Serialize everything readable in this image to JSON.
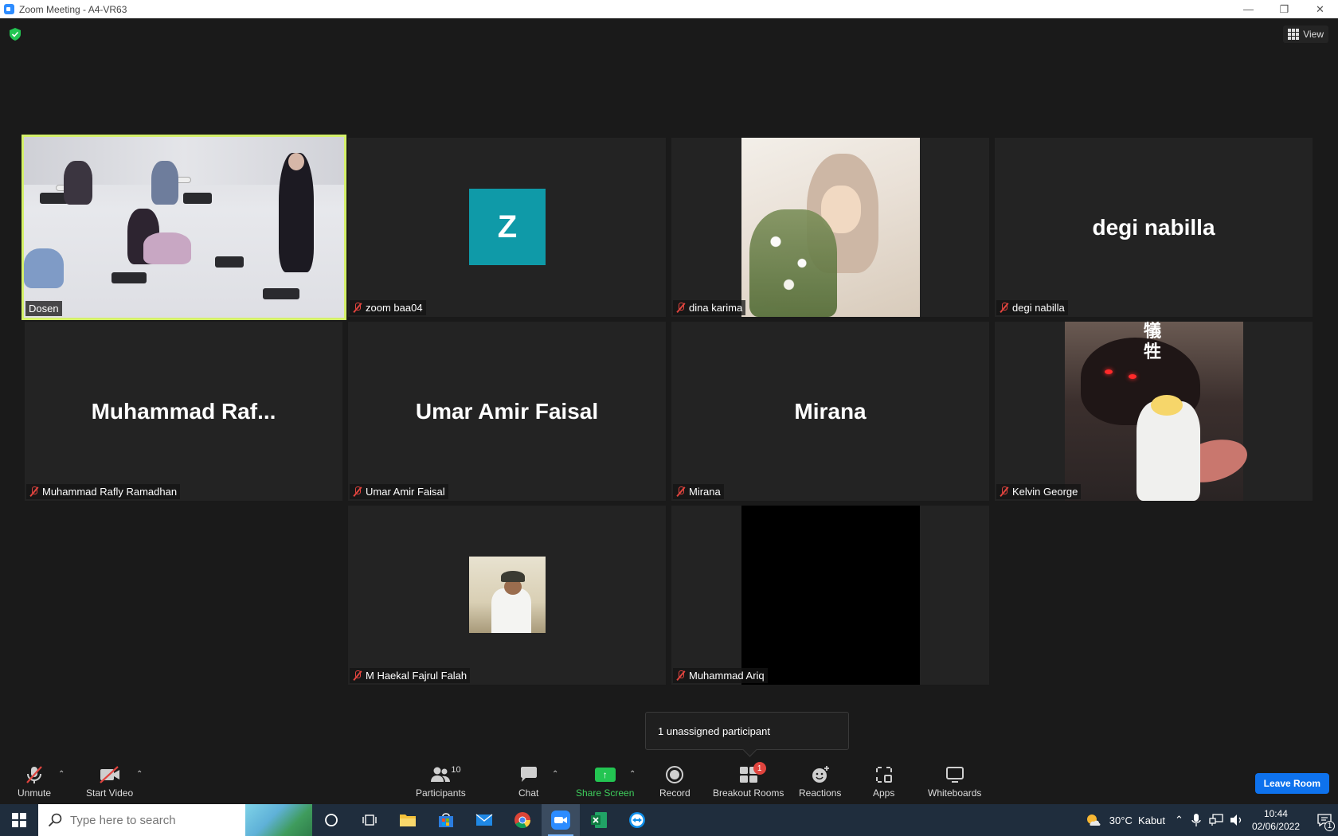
{
  "window": {
    "title": "Zoom Meeting - A4-VR63"
  },
  "header": {
    "view_label": "View"
  },
  "tiles": [
    {
      "name": "Dosen",
      "type": "video",
      "muted": false,
      "active": true
    },
    {
      "name": "zoom baa04",
      "type": "avatar",
      "avatar_letter": "Z",
      "avatar_color": "#0f9aa8",
      "muted": true
    },
    {
      "name": "dina karima",
      "type": "photo",
      "muted": true
    },
    {
      "name": "degi nabilla",
      "type": "name",
      "display": "degi nabilla",
      "muted": true
    },
    {
      "name": "Muhammad Rafly Ramadhan",
      "type": "name",
      "display": "Muhammad  Raf...",
      "muted": true
    },
    {
      "name": "Umar Amir Faisal",
      "type": "name",
      "display": "Umar Amir Faisal",
      "muted": true
    },
    {
      "name": "Mirana",
      "type": "name",
      "display": "Mirana",
      "muted": true
    },
    {
      "name": "Kelvin George",
      "type": "photo",
      "photo_text": "犠\n牲",
      "muted": true
    },
    {
      "name": "M Haekal Fajrul Falah",
      "type": "photo",
      "muted": true
    },
    {
      "name": "Muhammad Ariq",
      "type": "black",
      "muted": true
    }
  ],
  "tooltip": {
    "text": "1 unassigned participant"
  },
  "toolbar": {
    "unmute": "Unmute",
    "start_video": "Start Video",
    "participants": "Participants",
    "participants_count": "10",
    "chat": "Chat",
    "share_screen": "Share Screen",
    "record": "Record",
    "breakout_rooms": "Breakout Rooms",
    "breakout_badge": "1",
    "reactions": "Reactions",
    "apps": "Apps",
    "whiteboards": "Whiteboards",
    "leave": "Leave Room"
  },
  "taskbar": {
    "search_placeholder": "Type here to search",
    "weather": "30°C  Kabut",
    "time": "10:44",
    "date": "02/06/2022",
    "notification_count": "1"
  },
  "colors": {
    "accent": "#0e72ed",
    "active_border": "#d4f06a",
    "muted_red": "#e0443e",
    "share_green": "#23c552"
  }
}
